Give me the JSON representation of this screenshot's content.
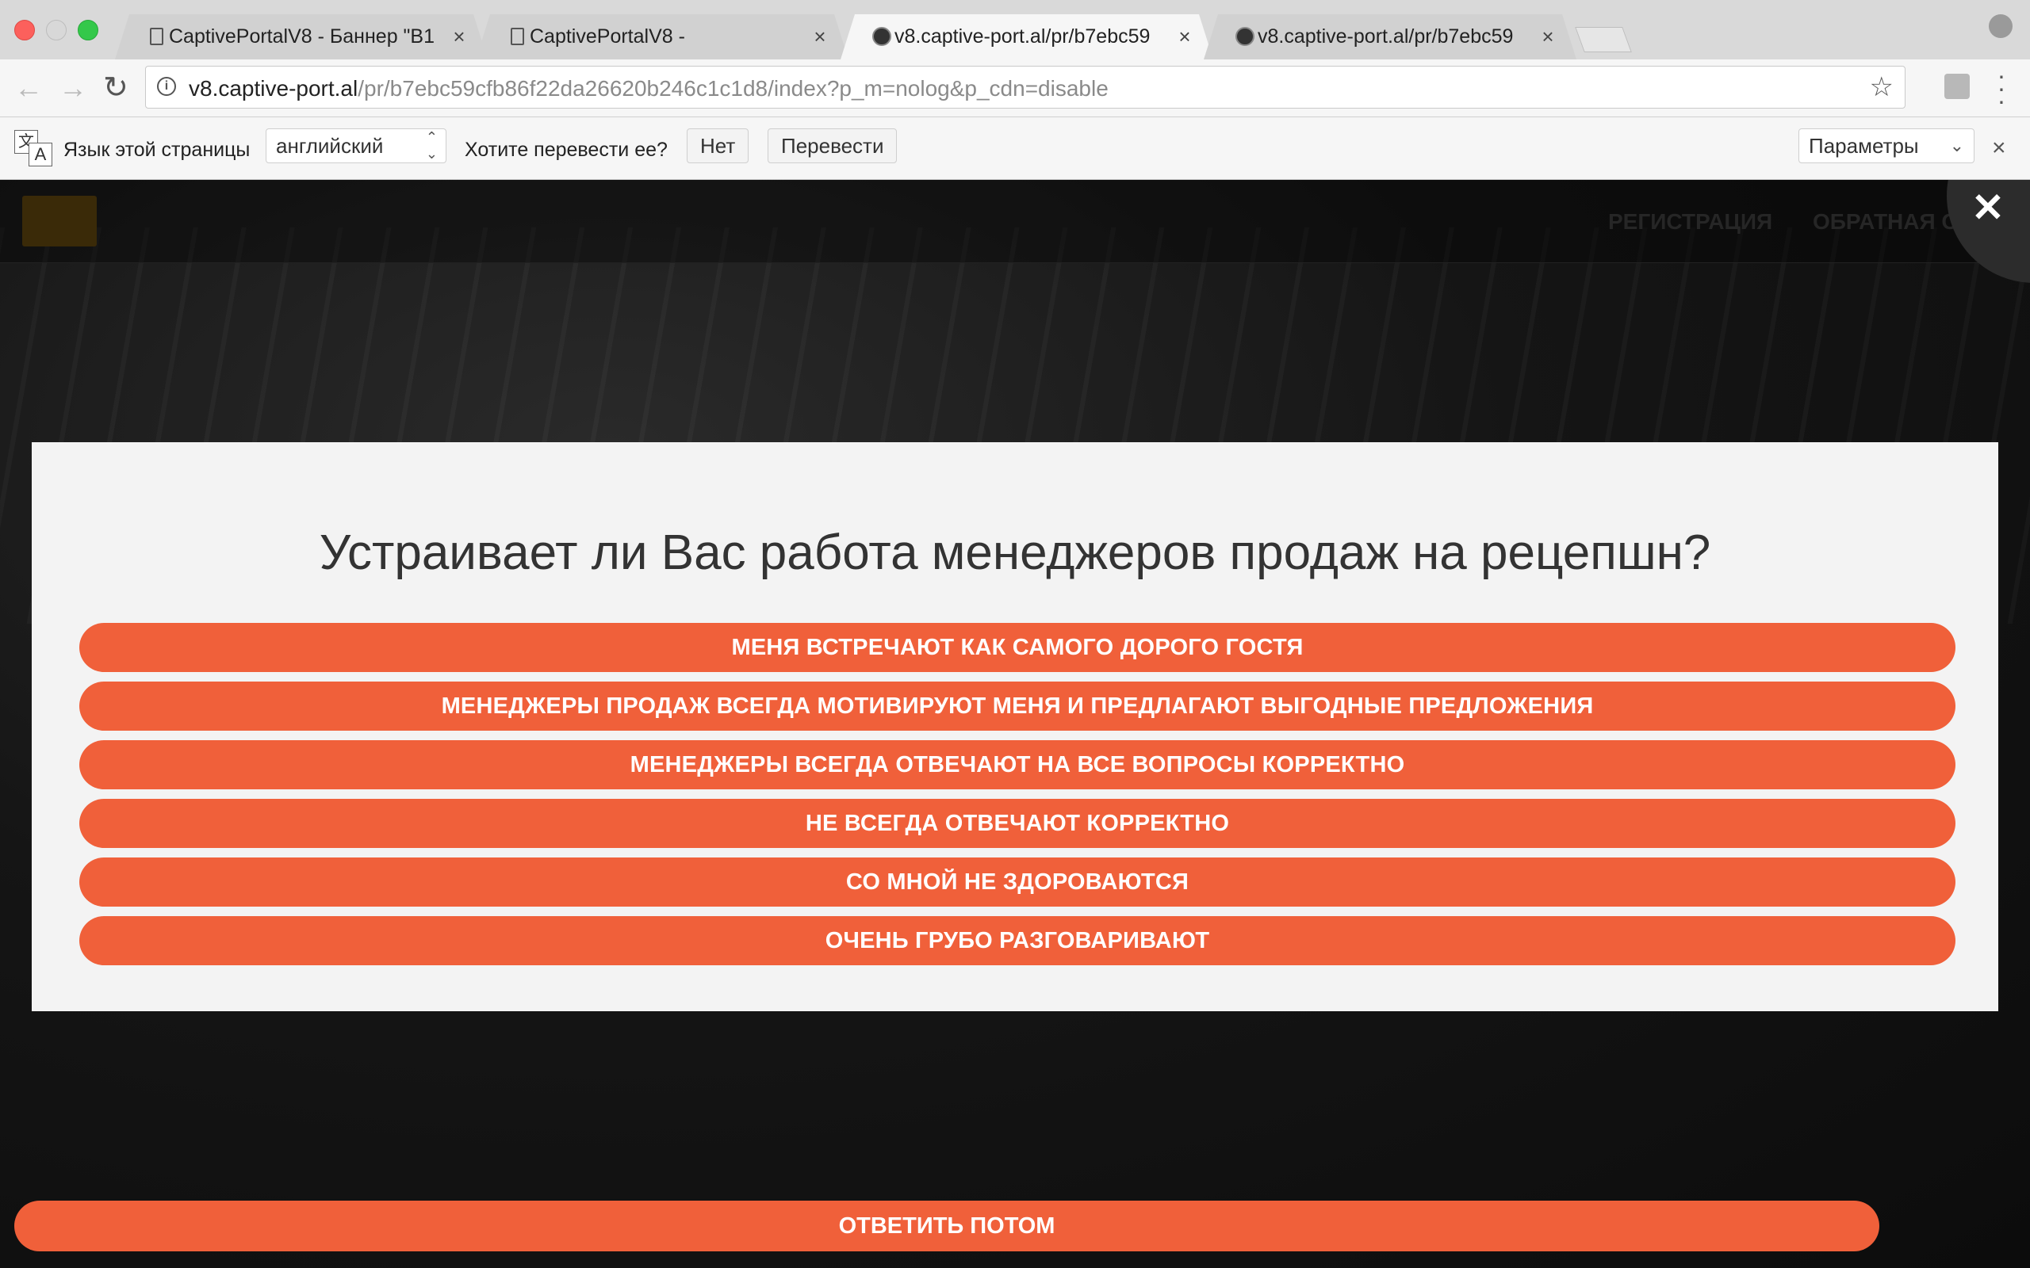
{
  "browser": {
    "tabs": [
      {
        "title": "CaptivePortalV8 - Баннер \"В1",
        "favicon": "document-icon",
        "active": false
      },
      {
        "title": "CaptivePortalV8 -",
        "favicon": "document-icon",
        "active": false
      },
      {
        "title": "v8.captive-port.al/pr/b7ebc59",
        "favicon": "site-logo-icon",
        "active": true
      },
      {
        "title": "v8.captive-port.al/pr/b7ebc59",
        "favicon": "site-logo-icon",
        "active": false
      }
    ],
    "tab_close": "×",
    "url_host": "v8.captive-port.al",
    "url_rest": "/pr/b7ebc59cfb86f22da26620b246c1c1d8/index?p_m=nolog&p_cdn=disable"
  },
  "translate_bar": {
    "page_language_label": "Язык этой страницы",
    "language_value": "английский",
    "prompt": "Хотите перевести ее?",
    "no_button": "Нет",
    "translate_button": "Перевести",
    "options_button": "Параметры",
    "close": "×"
  },
  "site": {
    "nav": [
      "РЕГИСТРАЦИЯ",
      "ОБРАТНАЯ СВЯЗЬ"
    ],
    "overlay_close": "✕"
  },
  "survey": {
    "question": "Устраивает ли Вас работа менеджеров продаж на рецепшн?",
    "answers": [
      "МЕНЯ ВСТРЕЧАЮТ КАК САМОГО ДОРОГО ГОСТЯ",
      "МЕНЕДЖЕРЫ ПРОДАЖ ВСЕГДА МОТИВИРУЮТ МЕНЯ И ПРЕДЛАГАЮТ ВЫГОДНЫЕ ПРЕДЛОЖЕНИЯ",
      "МЕНЕДЖЕРЫ ВСЕГДА ОТВЕЧАЮТ НА ВСЕ ВОПРОСЫ КОРРЕКТНО",
      "НЕ ВСЕГДА ОТВЕЧАЮТ КОРРЕКТНО",
      "СО МНОЙ НЕ ЗДОРОВАЮТСЯ",
      "ОЧЕНЬ ГРУБО РАЗГОВАРИВАЮТ"
    ],
    "later_button": "ОТВЕТИТЬ ПОТОМ"
  },
  "colors": {
    "accent": "#f0603a",
    "modal_bg": "#f3f3f3"
  }
}
